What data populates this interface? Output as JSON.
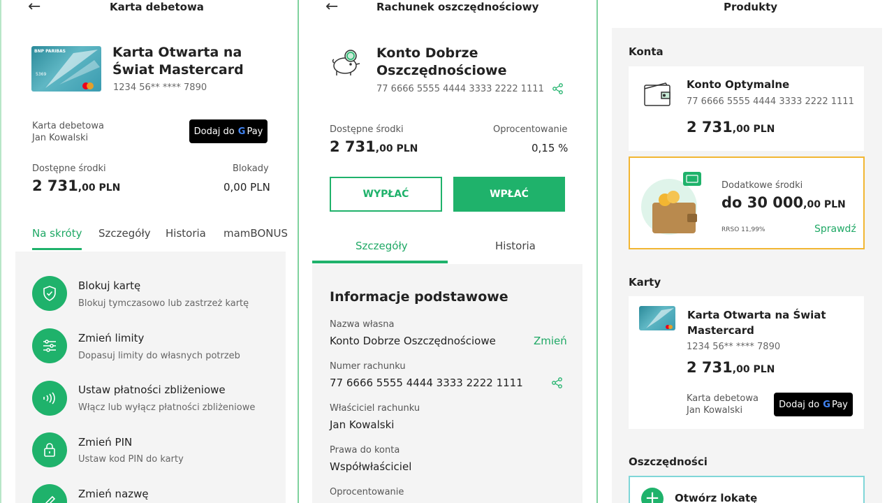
{
  "screen1": {
    "title": "Karta debetowa",
    "card_name": "Karta Otwarta na Świat Mastercard",
    "card_number": "1234 56** **** 7890",
    "card_brand_text": "BNP PARIBAS",
    "card_type_label": "Karta debetowa",
    "card_holder": "Jan Kowalski",
    "gpay_prefix": "Dodaj do",
    "gpay_g": "G",
    "gpay_pay": "Pay",
    "available_label": "Dostępne środki",
    "available_int": "2 731",
    "available_dec": ",00 PLN",
    "blocked_label": "Blokady",
    "blocked_value": "0,00 PLN",
    "tabs": [
      "Na skróty",
      "Szczegóły",
      "Historia",
      "mamBONUS"
    ],
    "actions": [
      {
        "title": "Blokuj kartę",
        "sub": "Blokuj tymczasowo lub zastrzeż kartę",
        "icon": "shield-icon"
      },
      {
        "title": "Zmień limity",
        "sub": "Dopasuj limity do własnych potrzeb",
        "icon": "sliders-icon"
      },
      {
        "title": "Ustaw płatności zbliżeniowe",
        "sub": "Włącz lub wyłącz płatności zbliżeniowe",
        "icon": "contactless-icon"
      },
      {
        "title": "Zmień PIN",
        "sub": "Ustaw kod PIN do karty",
        "icon": "lock-icon"
      },
      {
        "title": "Zmień nazwę",
        "sub": "",
        "icon": "pencil-icon"
      }
    ]
  },
  "screen2": {
    "title": "Rachunek oszczędnościowy",
    "account_name": "Konto Dobrze Oszczędnościowe",
    "account_number": "77 6666 5555 4444 3333 2222 1111",
    "available_label": "Dostępne środki",
    "available_int": "2 731",
    "available_dec": ",00 PLN",
    "interest_label": "Oprocentowanie",
    "interest_value": "0,15 %",
    "withdraw_label": "WYPŁAĆ",
    "deposit_label": "WPŁAĆ",
    "tabs": [
      "Szczegóły",
      "Historia"
    ],
    "section_title": "Informacje podstawowe",
    "fields": [
      {
        "label": "Nazwa własna",
        "value": "Konto Dobrze Oszczędnościowe",
        "action": "Zmień"
      },
      {
        "label": "Numer rachunku",
        "value": "77 6666 5555 4444 3333 2222 1111"
      },
      {
        "label": "Właściciel rachunku",
        "value": "Jan Kowalski"
      },
      {
        "label": "Prawa do konta",
        "value": "Współwłaściciel"
      },
      {
        "label": "Oprocentowanie",
        "value": ""
      }
    ]
  },
  "screen3": {
    "title": "Produkty",
    "accounts_label": "Konta",
    "account_name": "Konto Optymalne",
    "account_number": "77 6666 5555 4444 3333 2222 1111",
    "account_int": "2 731",
    "account_dec": ",00 PLN",
    "promo_label": "Dodatkowe środki",
    "promo_int": "do 30 000",
    "promo_dec": ",00 PLN",
    "promo_rrso": "RRSO 11,99%",
    "promo_link": "Sprawdź",
    "cards_label": "Karty",
    "card_name": "Karta Otwarta na Świat Mastercard",
    "card_number": "1234 56** **** 7890",
    "card_int": "2 731",
    "card_dec": ",00 PLN",
    "card_type_label": "Karta debetowa",
    "card_holder": "Jan Kowalski",
    "gpay_prefix": "Dodaj do",
    "gpay_g": "G",
    "gpay_pay": "Pay",
    "savings_label": "Oszczędności",
    "open_deposit": "Otwórz lokatę"
  },
  "colors": {
    "accent": "#1fb26b",
    "promo_border": "#f2b632",
    "savings_border": "#7fd6d8"
  }
}
